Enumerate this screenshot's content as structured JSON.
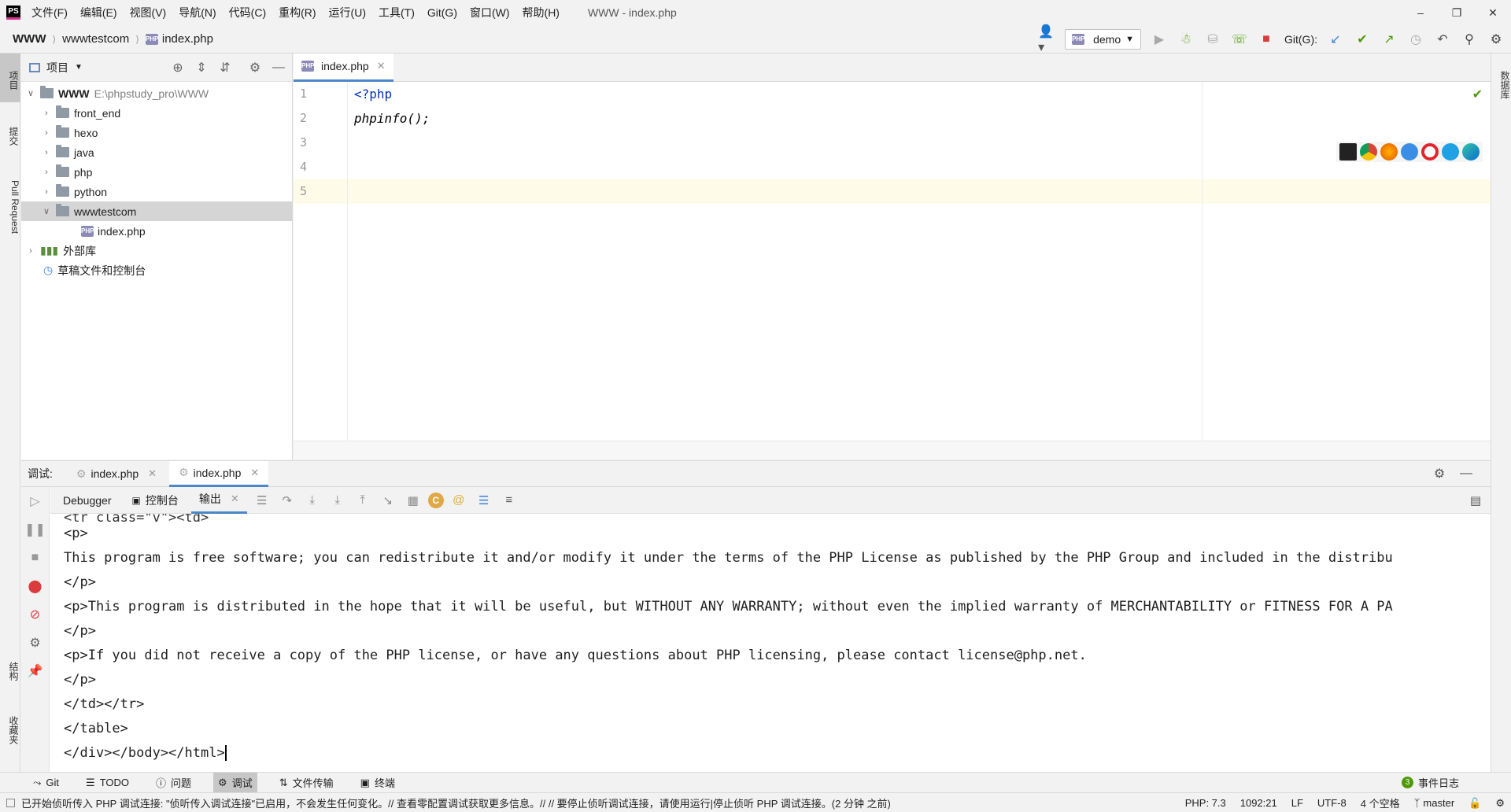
{
  "app": {
    "title": "WWW - index.php",
    "logo_text": "PS",
    "menus": [
      "文件(F)",
      "编辑(E)",
      "视图(V)",
      "导航(N)",
      "代码(C)",
      "重构(R)",
      "运行(U)",
      "工具(T)",
      "Git(G)",
      "窗口(W)",
      "帮助(H)"
    ]
  },
  "nav": {
    "root": "WWW",
    "folder": "wwwtestcom",
    "file": "index.php",
    "php_badge": "PHP",
    "run_config": "demo",
    "git_label": "Git(G):"
  },
  "left_strip": {
    "tabs": [
      "项目",
      "提交",
      "Pull Request",
      "结构",
      "收藏夹"
    ]
  },
  "right_strip": {
    "tabs": [
      "数据库"
    ]
  },
  "project": {
    "header_label": "项目",
    "tree": [
      {
        "label": "WWW",
        "path": "E:\\phpstudy_pro\\WWW",
        "type": "root"
      },
      {
        "label": "front_end",
        "type": "folder"
      },
      {
        "label": "hexo",
        "type": "folder"
      },
      {
        "label": "java",
        "type": "folder"
      },
      {
        "label": "php",
        "type": "folder"
      },
      {
        "label": "python",
        "type": "folder"
      },
      {
        "label": "wwwtestcom",
        "type": "folder-open"
      },
      {
        "label": "index.php",
        "type": "file"
      },
      {
        "label": "外部库",
        "type": "lib"
      },
      {
        "label": "草稿文件和控制台",
        "type": "scratch"
      }
    ]
  },
  "editor": {
    "tab_label": "index.php",
    "line_numbers": [
      "1",
      "2",
      "3",
      "4",
      "5"
    ],
    "lines": [
      "<?php",
      "phpinfo();",
      "",
      "",
      ""
    ]
  },
  "debug": {
    "label": "调试:",
    "tabs": [
      "index.php",
      "index.php"
    ],
    "subtabs": [
      "Debugger",
      "控制台",
      "输出"
    ],
    "output_lines": [
      "<p>",
      "This program is free software; you can redistribute it and/or modify it under the terms of the PHP License as published by the PHP Group and included in the distribu",
      "</p>",
      "<p>This program is distributed in the hope that it will be useful, but WITHOUT ANY WARRANTY; without even the implied warranty of MERCHANTABILITY or FITNESS FOR A PA",
      "</p>",
      "<p>If you did not receive a copy of the PHP license, or have any questions about PHP licensing, please contact license@php.net.",
      "</p>",
      "</td></tr>",
      "</table>",
      "</div></body></html>"
    ]
  },
  "bottom_tools": {
    "items": [
      "Git",
      "TODO",
      "问题",
      "调试",
      "文件传输",
      "终端"
    ],
    "event_log": "事件日志",
    "event_count": "3"
  },
  "status": {
    "message": "已开始侦听传入 PHP 调试连接: \"侦听传入调试连接\"已启用，不会发生任何变化。// 查看零配置调试获取更多信息。// // 要停止侦听调试连接，请使用运行|停止侦听 PHP 调试连接。(2 分钟 之前)",
    "php_version": "PHP: 7.3",
    "position": "1092:21",
    "line_ending": "LF",
    "encoding": "UTF-8",
    "indent": "4 个空格",
    "branch": "master"
  }
}
